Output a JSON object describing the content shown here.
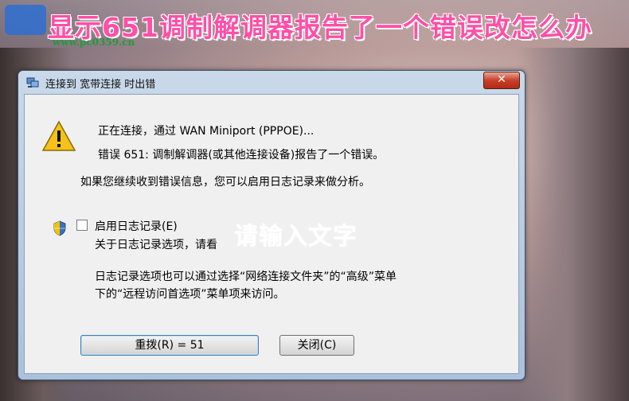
{
  "banner": {
    "title": "显示651调制解调器报告了一个错误改怎么办",
    "site_url": "www.pc0359.cn"
  },
  "dialog": {
    "title": "连接到 宽带连接 时出错",
    "close_glyph": "✕",
    "connecting_text": "正在连接，通过 WAN Miniport (PPPOE)...",
    "error_text": "错误 651: 调制解调器(或其他连接设备)报告了一个错误。",
    "advice_text": "如果您继续收到错误信息，您可以启用日志记录来做分析。",
    "logging_checkbox": {
      "label": "启用日志记录(E)",
      "checked": false
    },
    "logging_hint": "关于日志记录选项，请看",
    "description_line1": "日志记录选项也可以通过选择“网络连接文件夹”的“高级”菜单",
    "description_line2": "下的“远程访问首选项”菜单项来访问。",
    "redial_button": "重拨(R) = 51",
    "close_button": "关闭(C)"
  },
  "overlay": {
    "text": "请输入文字"
  },
  "colors": {
    "banner_pink": "#ff4fa6",
    "url_green": "#1f9a3b",
    "close_red": "#c8402a",
    "warning_yellow": "#f4c21a"
  },
  "icons": [
    "site-logo-icon",
    "network-icon",
    "close-icon",
    "warning-icon",
    "uac-shield-icon"
  ]
}
